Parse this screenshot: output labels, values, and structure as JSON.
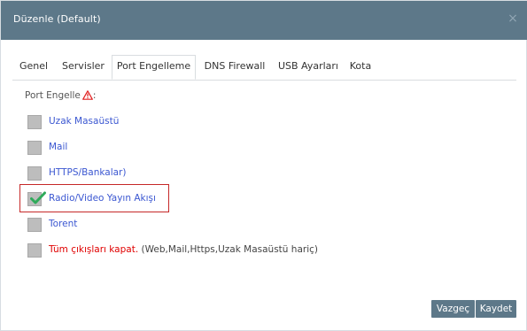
{
  "window": {
    "title": "Düzenle (Default)",
    "close_glyph": "×"
  },
  "tabs": [
    {
      "label": "Genel",
      "active": false
    },
    {
      "label": "Servisler",
      "active": false
    },
    {
      "label": "Port Engelleme",
      "active": true
    },
    {
      "label": "DNS Firewall",
      "active": false
    },
    {
      "label": "USB Ayarları",
      "active": false
    },
    {
      "label": "Kota",
      "active": false
    }
  ],
  "section": {
    "label": "Port Engelle",
    "label_suffix": ":",
    "icon": "warning-triangle-icon"
  },
  "options": [
    {
      "label": "Uzak Masaüstü",
      "checked": false
    },
    {
      "label": "Mail",
      "checked": false
    },
    {
      "label": "HTTPS/Bankalar)",
      "checked": false
    },
    {
      "label": "Radio/Video Yayın Akışı",
      "checked": true
    },
    {
      "label": "Torent",
      "checked": false
    },
    {
      "label_red": "Tüm çıkışları kapat.",
      "label_note": " (Web,Mail,Https,Uzak Masaüstü hariç)",
      "checked": false
    }
  ],
  "buttons": {
    "cancel": "Vazgeç",
    "save": "Kaydet"
  },
  "colors": {
    "title_bar": "#5d7889",
    "link_blue": "#3b57d1",
    "danger_red": "#e00000",
    "highlight_border": "#c62828",
    "check_green": "#2faa5a"
  }
}
